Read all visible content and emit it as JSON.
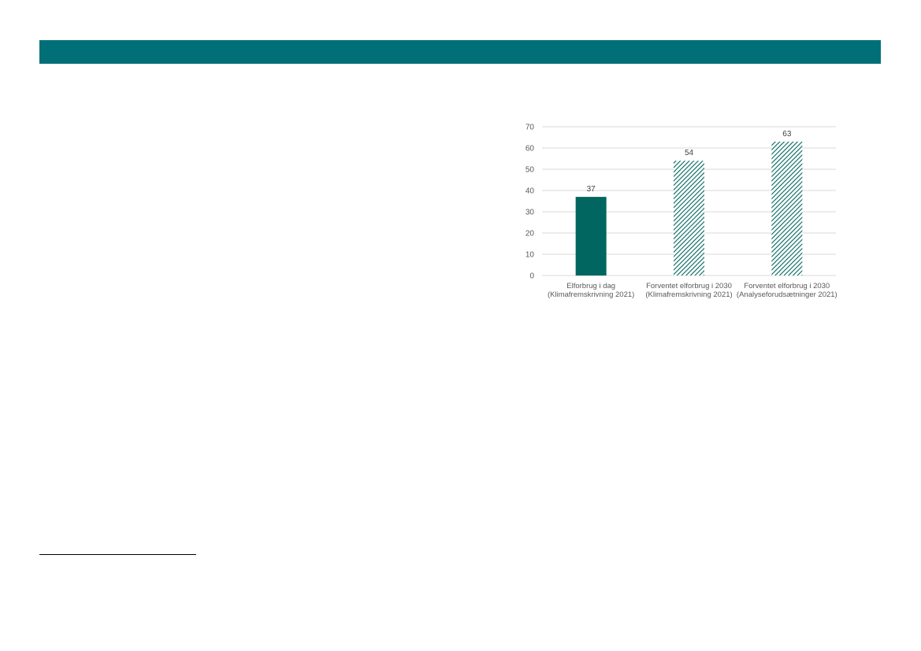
{
  "theme": {
    "accent": "#006f77",
    "bar_solid": "#00665f",
    "grid": "#d9d9d9",
    "axis_text": "#595959"
  },
  "chart_data": {
    "type": "bar",
    "categories": [
      [
        "Elforbrug i dag",
        "(Klimafremskrivning 2021)"
      ],
      [
        "Forventet elforbrug i 2030",
        "(Klimafremskrivning 2021)"
      ],
      [
        "Forventet elforbrug i 2030",
        "(Analyseforudsætninger 2021)"
      ]
    ],
    "values": [
      37,
      54,
      63
    ],
    "fill_styles": [
      "solid",
      "hatched",
      "hatched"
    ],
    "data_labels": [
      "37",
      "54",
      "63"
    ],
    "ylim": [
      0,
      70
    ],
    "yticks": [
      0,
      10,
      20,
      30,
      40,
      50,
      60,
      70
    ],
    "grid": true,
    "title": "",
    "xlabel": "",
    "ylabel": ""
  }
}
